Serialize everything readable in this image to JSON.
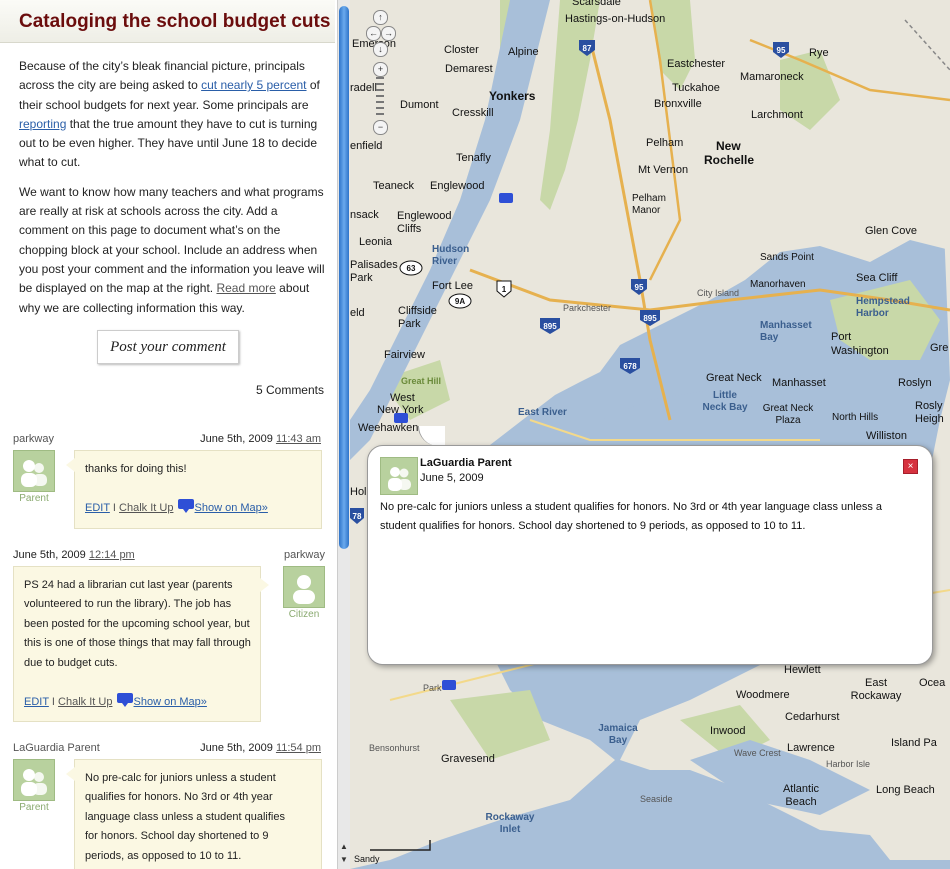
{
  "title": "Cataloging the school budget cuts",
  "intro": {
    "p1_a": "Because of the city’s bleak financial picture, principals across the city are being asked to ",
    "p1_link1": "cut nearly 5 percent",
    "p1_b": " of their school budgets for next year. Some principals are ",
    "p1_link2": "reporting",
    "p1_c": " that the true amount they have to cut is turning out to be even higher. They have until June 18 to decide what to cut.",
    "p2_a": "We want to know how many teachers and what programs are really at risk at schools across the city. Add a comment on this page to document what’s on the chopping block at your school. Include an address when you post your comment and the information you leave will be displayed on the map at the right. ",
    "p2_link": "Read more",
    "p2_b": " about why we are collecting information this way."
  },
  "post_comment_label": "Post your comment",
  "comment_count": "5 Comments",
  "comments": [
    {
      "author": "parkway",
      "date": "June 5th, 2009",
      "time": "11:43 am",
      "role": "Parent",
      "text": "thanks for doing this!",
      "edit": "EDIT",
      "sep": "I",
      "chalk": "Chalk It Up",
      "show": "Show on Map»"
    },
    {
      "author": "parkway",
      "date": "June 5th, 2009",
      "time": "12:14 pm",
      "role": "Citizen",
      "text": "PS 24 had a librarian cut last year (parents volunteered to run the library). The job has been posted for the upcoming school year, but this is one of those things that may fall through due to budget cuts.",
      "edit": "EDIT",
      "sep": "I",
      "chalk": "Chalk It Up",
      "show": "Show on Map»"
    },
    {
      "author": "LaGuardia Parent",
      "date": "June 5th, 2009",
      "time": "11:54 pm",
      "role": "Parent",
      "text": "No pre-calc for juniors unless a student qualifies for honors. No 3rd or 4th year language class unless a student qualifies for honors. School day shortened to 9 periods, as opposed to 10 to 11."
    }
  ],
  "popup": {
    "name": "LaGuardia Parent",
    "date": "June 5, 2009",
    "text": "No pre-calc for juniors unless a student qualifies for honors. No 3rd or 4th year language class unless a student qualifies for honors. School day shortened to 9 periods, as opposed to 10 to 11.",
    "close": "×"
  },
  "colors": {
    "title": "#6b0d0d",
    "link": "#2a5ea8",
    "bubble": "#fbf8e3",
    "avatar": "#b8d19e",
    "water": "#a8bfd9",
    "land": "#e9e6dc",
    "marker": "#2e4fd6"
  },
  "map_places": {
    "scarsdale": "Scarsdale",
    "hastings": "Hastings-on-Hudson",
    "emerson": "Emerson",
    "closter": "Closter",
    "alpine": "Alpine",
    "eastchester": "Eastchester",
    "rye": "Rye",
    "demarest": "Demarest",
    "mamaroneck": "Mamaroneck",
    "tuckahoe": "Tuckahoe",
    "yonkers": "Yonkers",
    "bradell": "radell",
    "dumont": "Dumont",
    "cresskill": "Cresskill",
    "bronxville": "Bronxville",
    "larchmont": "Larchmont",
    "enfield": "enfield",
    "pelham": "Pelham",
    "new": "New",
    "rochelle": "Rochelle",
    "tenafly": "Tenafly",
    "mtvernon": "Mt Vernon",
    "teaneck": "Teaneck",
    "englewood": "Englewood",
    "pelhammanor": "Pelham Manor",
    "nsack": "nsack",
    "englewoodcliffs": "Englewood Cliffs",
    "glencove": "Glen Cove",
    "leonia": "Leonia",
    "hudsonriver": "Hudson River",
    "sandspoint": "Sands Point",
    "palisades": "Palisades Park",
    "seacliff": "Sea Cliff",
    "fortlee": "Fort Lee",
    "manorhaven": "Manorhaven",
    "hempstead": "Hempstead Harbor",
    "cityisland": "City Island",
    "eld": "eld",
    "cliffside": "Cliffside Park",
    "parkchester": "Parkchester",
    "manhasset": "Manhasset Bay",
    "port": "Port Washington",
    "gre": "Gre",
    "fairview": "Fairview",
    "greatneck": "Great Neck",
    "manhassettown": "Manhasset",
    "roslyn": "Roslyn",
    "greathill": "Great Hill",
    "west": "West",
    "newyork": "New York",
    "littleneck": "Little Neck Bay",
    "greatneckplaza": "Great Neck Plaza",
    "eastriver": "East River",
    "northhills": "North Hills",
    "roslynheights": "Rosly Heigh",
    "weehawken": "Weehawken",
    "williston": "Williston",
    "holl": "Hol",
    "hewlett": "Hewlett",
    "east": "East Rockaway",
    "ocea": "Ocea",
    "woodmere": "Woodmere",
    "cedarhurst": "Cedarhurst",
    "parkslope": "Park",
    "inwood": "Inwood",
    "islandpark": "Island Pa",
    "jamaicabay": "Jamaica Bay",
    "lawrence": "Lawrence",
    "wavecrest": "Wave Crest",
    "harborisle": "Harbor Isle",
    "bensonhurst": "Bensonhurst",
    "gravesend": "Gravesend",
    "atlanticbeach": "Atlantic Beach",
    "longbeach": "Long Beach",
    "seaside": "Seaside",
    "rockawayinlet": "Rockaway Inlet",
    "sandy": "Sandy"
  },
  "highways": {
    "h87": "87",
    "h95a": "95",
    "h63": "63",
    "h1": "1",
    "h9a": "9A",
    "h95b": "95",
    "h895a": "895",
    "h895b": "895",
    "h678": "678",
    "h78": "78"
  },
  "map_controls": {
    "up": "↑",
    "left": "←",
    "right": "→",
    "down": "↓",
    "zoom_in": "+",
    "zoom_out": "−"
  },
  "scroll": {
    "up": "▲",
    "down": "▼"
  }
}
